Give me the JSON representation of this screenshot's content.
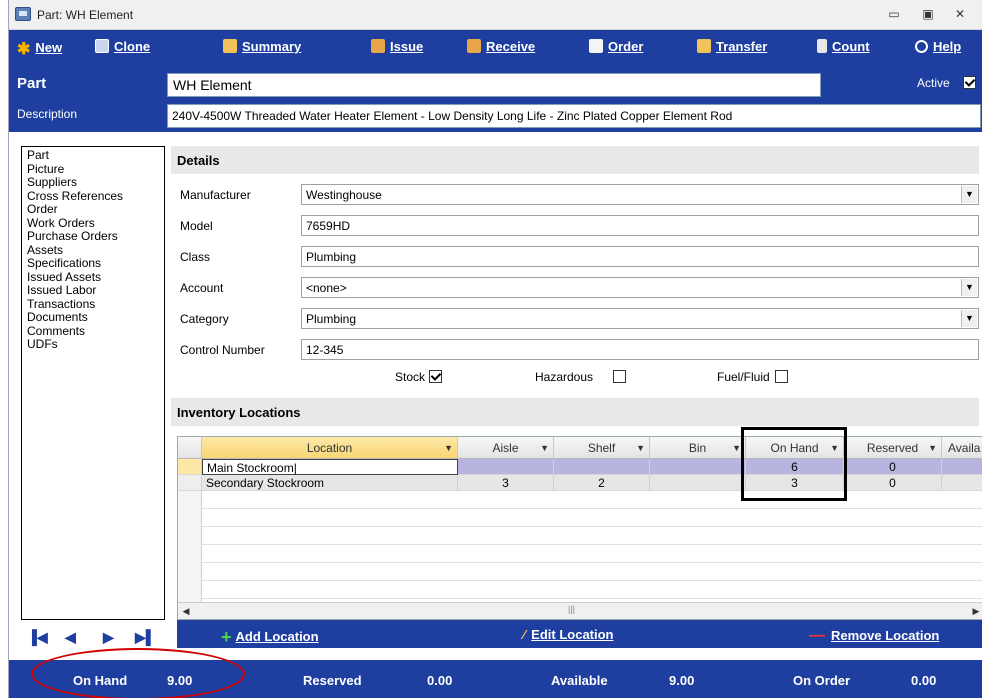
{
  "window": {
    "title": "Part: WH Element"
  },
  "toolbar": {
    "new": "New",
    "clone": "Clone",
    "summary": "Summary",
    "issue": "Issue",
    "receive": "Receive",
    "order": "Order",
    "transfer": "Transfer",
    "count": "Count",
    "help": "Help"
  },
  "header": {
    "part_label": "Part",
    "part_value": "WH Element",
    "description_label": "Description",
    "description_value": "240V-4500W Threaded Water Heater Element - Low Density Long Life - Zinc Plated Copper Element Rod",
    "active_label": "Active",
    "active_checked": true
  },
  "nav": {
    "items": [
      "Part",
      "Picture",
      "Suppliers",
      "Cross References",
      "Order",
      "Work Orders",
      "Purchase Orders",
      "Assets",
      "Specifications",
      "Issued Assets",
      "Issued Labor",
      "Transactions",
      "Documents",
      "Comments",
      "UDFs"
    ]
  },
  "details": {
    "heading": "Details",
    "manufacturer_label": "Manufacturer",
    "manufacturer": "Westinghouse",
    "model_label": "Model",
    "model": "7659HD",
    "class_label": "Class",
    "class": "Plumbing",
    "account_label": "Account",
    "account": "<none>",
    "category_label": "Category",
    "category": "Plumbing",
    "control_label": "Control Number",
    "control": "12-345",
    "stock_label": "Stock",
    "stock_checked": true,
    "hazardous_label": "Hazardous",
    "hazardous_checked": false,
    "fuel_label": "Fuel/Fluid",
    "fuel_checked": false
  },
  "inventory": {
    "heading": "Inventory Locations",
    "columns": [
      "Location",
      "Aisle",
      "Shelf",
      "Bin",
      "On Hand",
      "Reserved",
      "Availa"
    ],
    "rows": [
      {
        "location": "Main Stockroom",
        "aisle": "",
        "shelf": "",
        "bin": "",
        "on_hand": "6",
        "reserved": "0"
      },
      {
        "location": "Secondary Stockroom",
        "aisle": "3",
        "shelf": "2",
        "bin": "",
        "on_hand": "3",
        "reserved": "0"
      }
    ],
    "add_location": "Add Location",
    "edit_location": "Edit Location",
    "remove_location": "Remove Location"
  },
  "footer": {
    "on_hand_label": "On Hand",
    "on_hand": "9.00",
    "reserved_label": "Reserved",
    "reserved": "0.00",
    "available_label": "Available",
    "available": "9.00",
    "on_order_label": "On Order",
    "on_order": "0.00"
  },
  "colors": {
    "brand_blue": "#1f3fa0",
    "highlight_red": "#d00000"
  }
}
